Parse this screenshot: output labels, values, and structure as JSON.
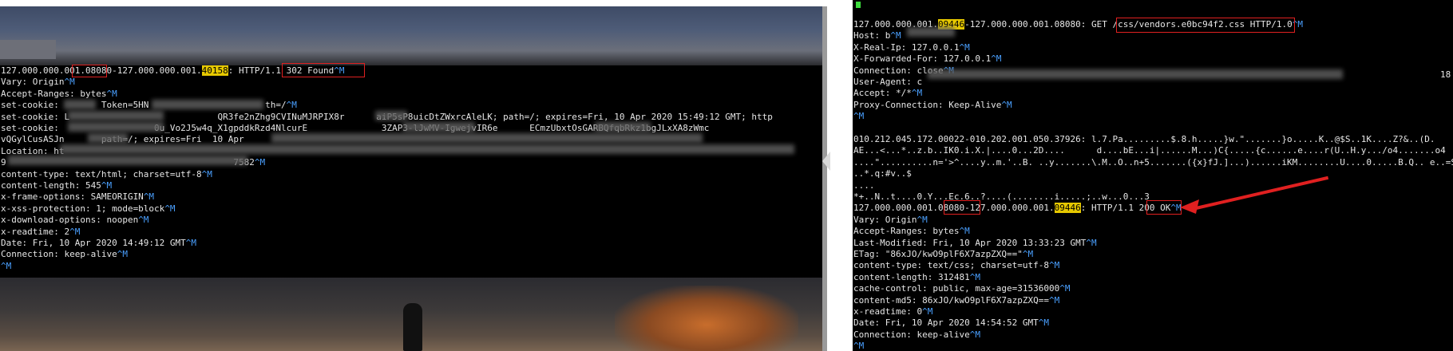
{
  "left_terminal": {
    "lines": [
      "127.000.000.001.08080-127.000.000.001.40158: HTTP/1.1 302 Found",
      "Vary: Origin",
      "Accept-Ranges: bytes",
      "set-cookie:        Token=5HN                      th=/",
      "set-cookie: L                            QR3fe2nZhg9CVINuMJRPIX8r      aiP5sP8uicDtZWxrcAleLK; path=/; expires=Fri, 10 Apr 2020 15:49:12 GMT; http",
      "set-cookie:                  0u_Vo2J5w4q_X1gpddkRzd4NlcurE              3ZAP3-lJwMV-IgwejvIR6e      ECmzUbxtOsGARBQfqbRkz1bgJLxXA8zWmc",
      "vQGylCusASJn       path=/; expires=Fri  10 Apr",
      "Location: ht",
      "9                                           7582",
      "content-type: text/html; charset=utf-8",
      "content-length: 545",
      "x-frame-options: SAMEORIGIN",
      "x-xss-protection: 1; mode=block",
      "x-download-options: noopen",
      "x-readtime: 2",
      "Date: Fri, 10 Apr 2020 14:49:12 GMT",
      "Connection: keep-alive",
      ""
    ],
    "cr_flags": [
      true,
      true,
      true,
      true,
      false,
      false,
      false,
      false,
      true,
      true,
      true,
      true,
      true,
      true,
      true,
      true,
      true,
      true
    ],
    "highlight_port": "40158"
  },
  "right_terminal": {
    "lines": [
      "127.000.000.001.09446-127.000.000.001.08080: GET /css/vendors.e0bc94f2.css HTTP/1.0",
      "Host: b",
      "X-Real-Ip: 127.0.0.1",
      "X-Forwarded-For: 127.0.0.1",
      "Connection: close",
      "User-Agent: c",
      "Accept: */*",
      "Proxy-Connection: Keep-Alive",
      "",
      "",
      "010.212.045.172.00022-010.202.001.050.37926: l.7.Pa.........$.8.h.....}w.\".......}o.....K..@$S..1K....Z?&..(D.",
      "AE...<...*..z.b..IK0.i.X.|....0...2D....      d....bE...i|......M...)C{.....{c......e....r(U..H.y.../o4.......o4",
      "....\"..........n='>^....y..m.'..B. ..y.......\\.M..O..n+5.......({x}fJ.]...)......iKM........U....0.....B.Q.. e..=SI.",
      "..*.q:#v..$",
      "....",
      "*+..N..t....0.Y...Ec.6..?....(........i.....;..w...0...3",
      "127.000.000.001.08080-127.000.000.001.09446: HTTP/1.1 200 OK",
      "Vary: Origin",
      "Accept-Ranges: bytes",
      "Last-Modified: Fri, 10 Apr 2020 13:33:23 GMT",
      "ETag: \"86xJO/kwO9plF6X7azpZXQ==\"",
      "content-type: text/css; charset=utf-8",
      "content-length: 312481",
      "cache-control: public, max-age=31536000",
      "content-md5: 86xJO/kwO9plF6X7azpZXQ==",
      "x-readtime: 0",
      "Date: Fri, 10 Apr 2020 14:54:52 GMT",
      "Connection: keep-alive",
      ""
    ],
    "cr_flags": [
      true,
      true,
      true,
      true,
      true,
      false,
      true,
      true,
      true,
      false,
      false,
      false,
      false,
      false,
      false,
      false,
      true,
      true,
      true,
      true,
      true,
      true,
      true,
      true,
      true,
      true,
      true,
      true,
      true
    ],
    "highlight_port": "09446",
    "trailing_number": "18"
  },
  "cr_marker": "^M",
  "colors": {
    "terminal_bg": "#000000",
    "text": "#e6e6e6",
    "cr_marker": "#4aa0ff",
    "highlight": "#e6c800",
    "annotation": "#e02020"
  }
}
